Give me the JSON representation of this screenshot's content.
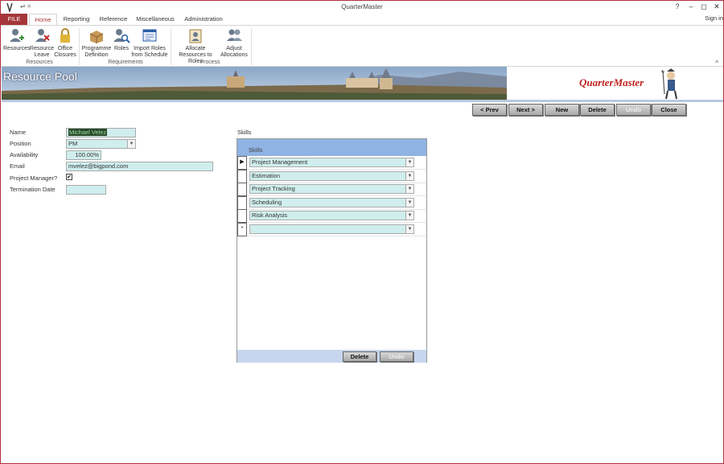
{
  "window": {
    "title": "QuarterMaster",
    "help": "?",
    "minimize": "–",
    "restore": "◻",
    "close": "✕",
    "sign_in": "Sign in",
    "qat": "⇌ ="
  },
  "tabs": [
    "FILE",
    "Home",
    "Reporting",
    "Reference",
    "Miscellaneous",
    "Administration"
  ],
  "ribbon": {
    "buttons": {
      "resources": "Resources",
      "resource_leave_1": "Resource",
      "resource_leave_2": "Leave",
      "office_closures_1": "Office",
      "office_closures_2": "Closures",
      "programme_def_1": "Programme",
      "programme_def_2": "Definition",
      "roles": "Roles",
      "import_roles_1": "Import Roles",
      "import_roles_2": "from Schedule",
      "allocate_1": "Allocate",
      "allocate_2": "Resources to Roles",
      "adjust_1": "Adjust",
      "adjust_2": "Allocations"
    },
    "groups": {
      "resources": "Resources",
      "requirements": "Requirements",
      "process": "Process"
    },
    "collapse": "^"
  },
  "banner": {
    "form_title": "Resource Pool",
    "logo_text": "QuarterMaster"
  },
  "nav": {
    "prev": "< Prev",
    "next": "Next >",
    "new": "New",
    "delete": "Delete",
    "undo": "Undo",
    "close": "Close"
  },
  "form": {
    "name_label": "Name",
    "name_value": "Michael Velez",
    "position_label": "Position",
    "position_value": "PM",
    "availability_label": "Availability",
    "availability_value": "100.00%",
    "email_label": "Email",
    "email_value": "mvelez@bigpond.com",
    "pm_label": "Project Manager?",
    "pm_checked": "✔",
    "termination_label": "Termination Date",
    "termination_value": ""
  },
  "skills": {
    "section_label": "Skills",
    "column_header": "Skills",
    "rows": [
      "Project Management",
      "Estimation",
      "Project Tracking",
      "Scheduling",
      "Risk Analysis",
      ""
    ],
    "current_marker": "▶",
    "new_marker": "*",
    "delete": "Delete",
    "undo": "Undo"
  },
  "colors": {
    "accent": "#a4373a",
    "field_bg": "#cfeeed",
    "header_blue": "#8fb3e3",
    "footer_blue": "#c6d6ee"
  }
}
